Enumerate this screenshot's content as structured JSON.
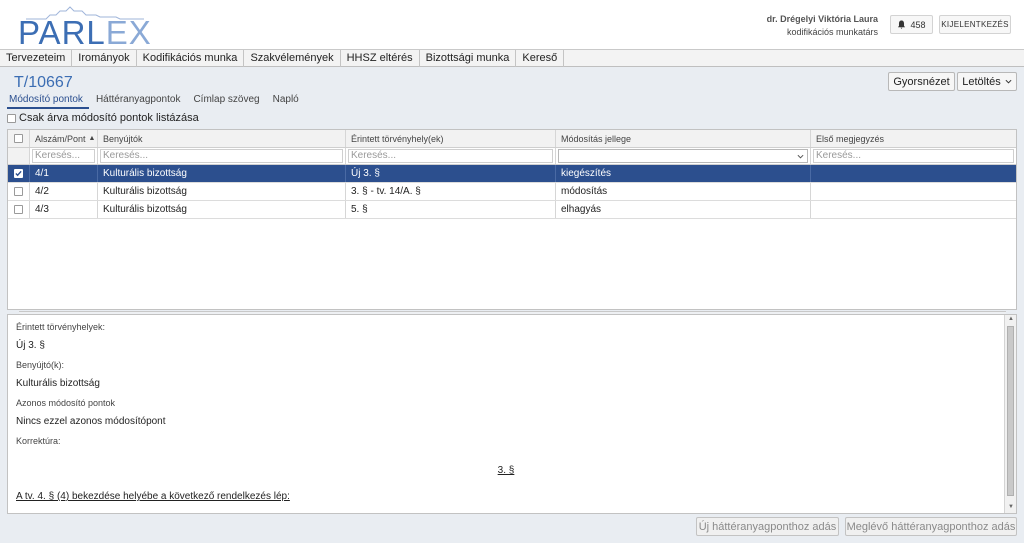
{
  "header": {
    "logo_text_a": "PARL",
    "logo_text_b": "EX",
    "user_name": "dr. Drégelyi Viktória Laura",
    "user_role": "kodifikációs munkatárs",
    "notification_count": "458",
    "logout_label": "KIJELENTKEZÉS"
  },
  "mainnav": [
    "Tervezeteim",
    "Irományok",
    "Kodifikációs munka",
    "Szakvélemények",
    "HHSZ eltérés",
    "Bizottsági munka",
    "Kereső"
  ],
  "doc": {
    "title": "T/10667",
    "preview_label": "Gyorsnézet",
    "download_label": "Letöltés"
  },
  "subtabs": [
    "Módosító pontok",
    "Háttéranyagpontok",
    "Címlap szöveg",
    "Napló"
  ],
  "orphan_label": "Csak árva módosító pontok listázása",
  "grid": {
    "headers": [
      "Alszám/Pont",
      "Benyújtók",
      "Érintett törvényhely(ek)",
      "Módosítás jellege",
      "Első megjegyzés"
    ],
    "filter_placeholder": "Keresés...",
    "rows": [
      {
        "id": "4/1",
        "submitter": "Kulturális bizottság",
        "location": "Új 3. §",
        "type": "kiegészítés",
        "note": "",
        "selected": true
      },
      {
        "id": "4/2",
        "submitter": "Kulturális bizottság",
        "location": "3. § - tv. 14/A. §",
        "type": "módosítás",
        "note": "",
        "selected": false
      },
      {
        "id": "4/3",
        "submitter": "Kulturális bizottság",
        "location": "5. §",
        "type": "elhagyás",
        "note": "",
        "selected": false
      }
    ]
  },
  "detail": {
    "affected_label": "Érintett törvényhelyek:",
    "affected_value": "Új 3. §",
    "submitter_label": "Benyújtó(k):",
    "submitter_value": "Kulturális bizottság",
    "same_label": "Azonos módosító pontok",
    "same_value": "Nincs ezzel azonos módosítópont",
    "correction_label": "Korrektúra:",
    "section_heading": "3. §",
    "text_line": "A tv. 4. § (4) bekezdése helyébe a következő rendelkezés lép:"
  },
  "buttons": {
    "new_background": "Új háttéranyagponthoz adás",
    "existing_background": "Meglévő háttéranyagponthoz adás"
  }
}
